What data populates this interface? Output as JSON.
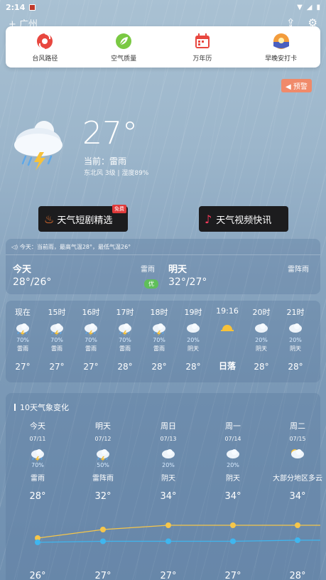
{
  "status": {
    "time": "2:14"
  },
  "topbar": {
    "city": "+ 广州"
  },
  "quickmenu": [
    {
      "label": "台风路径",
      "icon": "typhoon-icon"
    },
    {
      "label": "空气质量",
      "icon": "leaf-icon"
    },
    {
      "label": "万年历",
      "icon": "calendar-icon"
    },
    {
      "label": "早晚安打卡",
      "icon": "sunrise-icon"
    }
  ],
  "alert": {
    "label": "预警"
  },
  "current": {
    "temp": "27°",
    "condition": "当前：雷雨",
    "wind": "东北风 3级 | 湿度89%"
  },
  "promos": {
    "short_drama": "天气短剧精选",
    "short_drama_badge": "免费",
    "video": "天气视频快讯"
  },
  "summary": {
    "notice": "今天：当前雨，最高气温28°，最低气温26°",
    "today": {
      "name": "今天",
      "range": "28°/26°",
      "condition": "雷雨",
      "aqi": "优"
    },
    "tomorrow": {
      "name": "明天",
      "range": "32°/27°",
      "condition": "雷阵雨"
    }
  },
  "hourly": [
    {
      "time": "现在",
      "prob": "70%",
      "cond": "雷雨",
      "temp": "27°",
      "icon": "thunderstorm-icon"
    },
    {
      "time": "15时",
      "prob": "70%",
      "cond": "雷雨",
      "temp": "27°",
      "icon": "thunderstorm-icon"
    },
    {
      "time": "16时",
      "prob": "70%",
      "cond": "雷雨",
      "temp": "27°",
      "icon": "thunderstorm-icon"
    },
    {
      "time": "17时",
      "prob": "70%",
      "cond": "雷雨",
      "temp": "28°",
      "icon": "thunderstorm-icon"
    },
    {
      "time": "18时",
      "prob": "70%",
      "cond": "雷雨",
      "temp": "28°",
      "icon": "thunderstorm-icon"
    },
    {
      "time": "19时",
      "prob": "20%",
      "cond": "阴天",
      "temp": "28°",
      "icon": "cloud-icon"
    },
    {
      "time": "19:16",
      "prob": "",
      "cond": "",
      "temp": "日落",
      "icon": "sunset-icon"
    },
    {
      "time": "20时",
      "prob": "20%",
      "cond": "阴天",
      "temp": "28°",
      "icon": "cloud-icon"
    },
    {
      "time": "21时",
      "prob": "20%",
      "cond": "阴天",
      "temp": "28°",
      "icon": "cloud-icon"
    }
  ],
  "tenday": {
    "title": "10天气象变化",
    "days": [
      {
        "day": "今天",
        "date": "07/11",
        "prob": "70%",
        "cond": "雷雨",
        "hi": "28°",
        "lo": "26°",
        "icon": "thunderstorm-icon"
      },
      {
        "day": "明天",
        "date": "07/12",
        "prob": "50%",
        "cond": "雷阵雨",
        "hi": "32°",
        "lo": "27°",
        "icon": "thunder-shower-icon"
      },
      {
        "day": "周日",
        "date": "07/13",
        "prob": "20%",
        "cond": "阴天",
        "hi": "34°",
        "lo": "27°",
        "icon": "cloud-icon"
      },
      {
        "day": "周一",
        "date": "07/14",
        "prob": "20%",
        "cond": "阴天",
        "hi": "34°",
        "lo": "27°",
        "icon": "cloud-icon"
      },
      {
        "day": "周二",
        "date": "07/15",
        "prob": "",
        "cond": "大部分地区多云",
        "hi": "34°",
        "lo": "28°",
        "icon": "partly-cloudy-icon"
      }
    ]
  },
  "colors": {
    "high_line": "#f6c64a",
    "low_line": "#3fb6ef"
  }
}
